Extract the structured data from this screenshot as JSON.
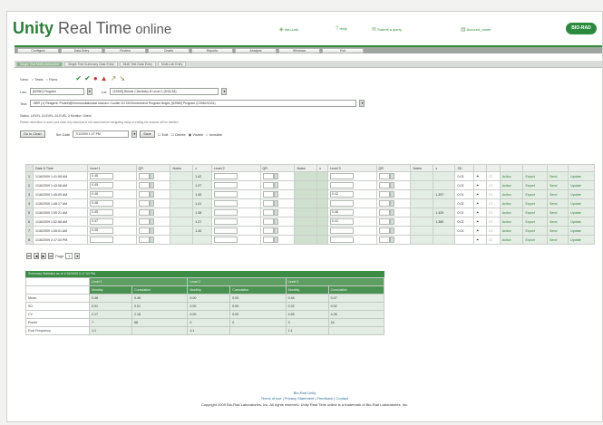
{
  "brand": {
    "name_bold": "Unity",
    "name_rest": " Real Time",
    "name_suffix": " online",
    "logo": "BIO-RAD"
  },
  "top_links": [
    {
      "icon": "◈",
      "label": "Info-Link"
    },
    {
      "icon": "?",
      "label": "Help"
    },
    {
      "icon": "✉",
      "label": "Submit a query"
    },
    {
      "icon": "▤",
      "label": "Account_name"
    }
  ],
  "menu": [
    "Configure",
    "Data Entry",
    "Review",
    "Charts",
    "Reports",
    "Analysis",
    "Windows",
    "Exit"
  ],
  "submenu": [
    "Single Test Multi-Instrument",
    "Single Test Summary Data Entry",
    "Multi Test Data Entry",
    "Multi-Lab Entry"
  ],
  "toolbar": {
    "view_label": "View:",
    "view_options": [
      "Tests",
      "Runs"
    ],
    "icons": [
      "add-row",
      "edit-row",
      "delete-row",
      "chart",
      "sort-asc",
      "sort-desc"
    ]
  },
  "selectors": {
    "lab_label": "Lab:",
    "lab_value": "[62960] Program",
    "lot_label": "Lot:",
    "lot_value": "[12505] Biorad Chemistry B Level 1 (5/31/18)",
    "test_label": "Test:",
    "test_value": "GBR (1) Reagent: Protein@Immunodiabostat Instrum: Coulter DJ DIG/Instrument Program Bright, [62960] Program (C0962/1001)"
  },
  "info": {
    "status": "Status: LEVEL 1/LEVEL 2/LEVEL 3  Monitor: Direct",
    "note": "Please remember to save your data. Any data that is not saved before navigating away or exiting the session will be deleted."
  },
  "controls": {
    "goto_label": "Go to Chart",
    "date_label": "Set Date",
    "date_value": "7/1/2009 1:47 PM",
    "save_label": "Save",
    "edit_label": "Edit",
    "delete_label": "Delete",
    "shown_label": "Visible",
    "hidden_label": "Invisible"
  },
  "grid": {
    "headers": [
      "",
      "Date & Time",
      "Level 1",
      "QR",
      "Notes",
      "x",
      "Level 2",
      "QR",
      "Notes",
      "x",
      "Level 3",
      "QR",
      "Notes",
      "x",
      "SD",
      "",
      "",
      "",
      "",
      "",
      ""
    ],
    "rows": [
      {
        "n": "1",
        "dt": "1/16/2009 1:41:08 AM",
        "l1": "0.45",
        "x1": "1.42",
        "l3": "",
        "x3": "",
        "sd": "0.02"
      },
      {
        "n": "2",
        "dt": "1/16/2009 1:43:08 AM",
        "l1": "0.45",
        "x1": "1.37",
        "l3": "",
        "x3": "",
        "sd": "0.02"
      },
      {
        "n": "3",
        "dt": "1/16/2009 1:45:09 AM",
        "l1": "0.46",
        "x1": "1.40",
        "l3": "0.42",
        "x3": "1.397",
        "sd": "0.01"
      },
      {
        "n": "4",
        "dt": "1/16/2009 1:48:17 AM",
        "l1": "0.48",
        "x1": "1.41",
        "l3": "",
        "x3": "",
        "sd": "0.02"
      },
      {
        "n": "5",
        "dt": "1/16/2009 1:50:21 AM",
        "l1": "0.45",
        "x1": "1.38",
        "l3": "0.46",
        "x3": "1.429",
        "sd": "0.01"
      },
      {
        "n": "6",
        "dt": "1/16/2009 1:52:58 AM",
        "l1": "0.47",
        "x1": "1.37",
        "l3": "0.41",
        "x3": "1.389",
        "sd": "0.02"
      },
      {
        "n": "7",
        "dt": "1/16/2009 1:55:01 AM",
        "l1": "0.45",
        "x1": "1.40",
        "l3": "",
        "x3": "",
        "sd": "0.02"
      },
      {
        "n": "8",
        "dt": "1/16/2009 2:17:34 PM",
        "l1": "",
        "x1": "",
        "l3": "",
        "x3": "",
        "sd": ""
      }
    ],
    "row_actions": [
      "Action",
      "Export",
      "Send",
      "Update"
    ]
  },
  "pager": {
    "page_label": "Page",
    "page_value": "1"
  },
  "summary": {
    "title": "Summary Statistics as of 1/16/2009 2:17:34 PM",
    "level_headers": [
      "Level 1",
      "Level 2",
      "Level 3"
    ],
    "sub_headers": [
      "Monthly",
      "Cumulative"
    ],
    "rows": [
      {
        "label": "Mean",
        "vals": [
          "0.46",
          "0.46",
          "0.00",
          "0.00",
          "0.44",
          "0.47"
        ]
      },
      {
        "label": "SD",
        "vals": [
          "0.01",
          "0.01",
          "0.00",
          "0.00",
          "0.02",
          "0.02"
        ]
      },
      {
        "label": "CV",
        "vals": [
          "2.17",
          "2.18",
          "0.00",
          "0.00",
          "4.55",
          "4.26"
        ]
      },
      {
        "label": "Points",
        "vals": [
          "7",
          "68",
          "0",
          "0",
          "3",
          "24"
        ]
      },
      {
        "label": "Eval Frequency",
        "vals": [
          "1:1",
          "",
          "1:1",
          "",
          "1:1",
          ""
        ]
      }
    ]
  },
  "footer": {
    "links_top": [
      "Bio-Rad",
      "Unity"
    ],
    "links_bottom": [
      "Terms of use",
      "Privacy Statement",
      "Feedback",
      "Contact"
    ],
    "copyright": "Copyright 2009 Bio-Rad Laboratories, Inc. All rights reserved. Unity Real Time online is a trademark of Bio-Rad Laboratories, Inc."
  },
  "colors": {
    "brand_green": "#2e7d3a",
    "menu_gray": "#9fa59f",
    "summary_green": "#3c8c46"
  }
}
